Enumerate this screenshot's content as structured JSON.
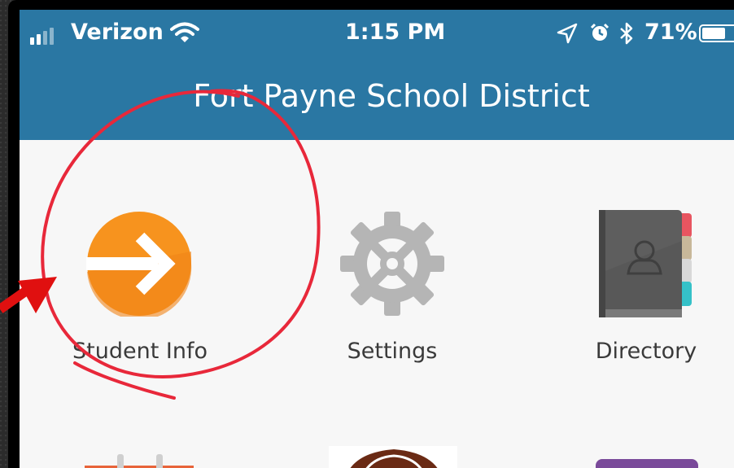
{
  "status_bar": {
    "carrier": "Verizon",
    "time": "1:15 PM",
    "battery_percent": "71%",
    "battery_level": 0.71,
    "icons": [
      "signal-icon",
      "wifi-icon",
      "location-icon",
      "alarm-icon",
      "bluetooth-icon",
      "battery-icon"
    ]
  },
  "header": {
    "title": "Fort Payne School District"
  },
  "tiles": [
    {
      "label": "Student Info",
      "icon": "arrow-right-circle-icon",
      "color": "#f7931e"
    },
    {
      "label": "Settings",
      "icon": "gear-icon",
      "color": "#b3b3b3"
    },
    {
      "label": "Directory",
      "icon": "address-book-icon",
      "color": "#5a5a5a"
    }
  ],
  "partial_tiles": [
    {
      "icon": "calendar-icon"
    },
    {
      "icon": "football-icon"
    },
    {
      "icon": "purple-tile-icon",
      "color": "#7a4a9a"
    }
  ],
  "annotation": {
    "circle_color": "#e8283a",
    "arrow_color": "#e01010"
  }
}
